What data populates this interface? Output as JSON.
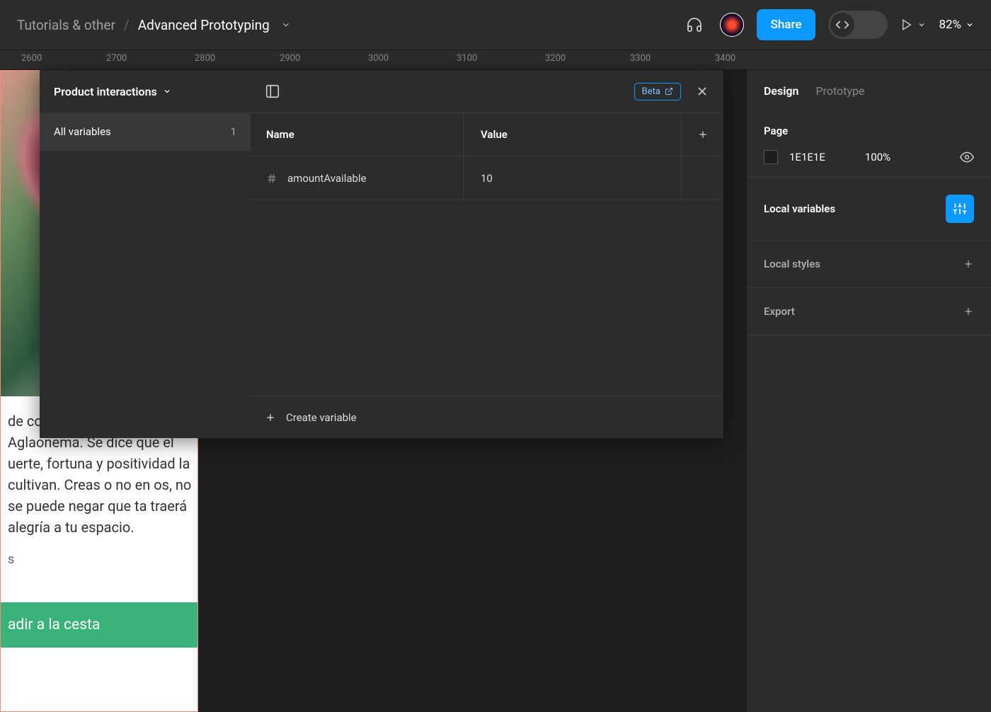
{
  "breadcrumb": {
    "parent": "Tutorials & other",
    "current": "Advanced Prototyping"
  },
  "topbar": {
    "share": "Share",
    "zoom": "82%"
  },
  "ruler": {
    "ticks": [
      "2600",
      "2700",
      "2800",
      "2900",
      "3000",
      "3100",
      "3200",
      "3300",
      "3400"
    ]
  },
  "varpanel": {
    "title": "Product interactions",
    "sidebar_item": "All variables",
    "sidebar_count": "1",
    "beta": "Beta",
    "col_name": "Name",
    "col_value": "Value",
    "rows": [
      {
        "name": "amountAvailable",
        "value": "10"
      }
    ],
    "create": "Create variable"
  },
  "frame": {
    "text": "de color en tu casa con esta Aglaonema. Se dice que el uerte, fortuna y positividad la cultivan. Creas o no en os, no se puede negar que ta traerá alegría a tu espacio.",
    "sub": "s",
    "button": "adir a la cesta"
  },
  "rsidebar": {
    "tab_design": "Design",
    "tab_prototype": "Prototype",
    "page_title": "Page",
    "page_color": "1E1E1E",
    "page_opacity": "100%",
    "local_variables": "Local variables",
    "local_styles": "Local styles",
    "export": "Export"
  }
}
